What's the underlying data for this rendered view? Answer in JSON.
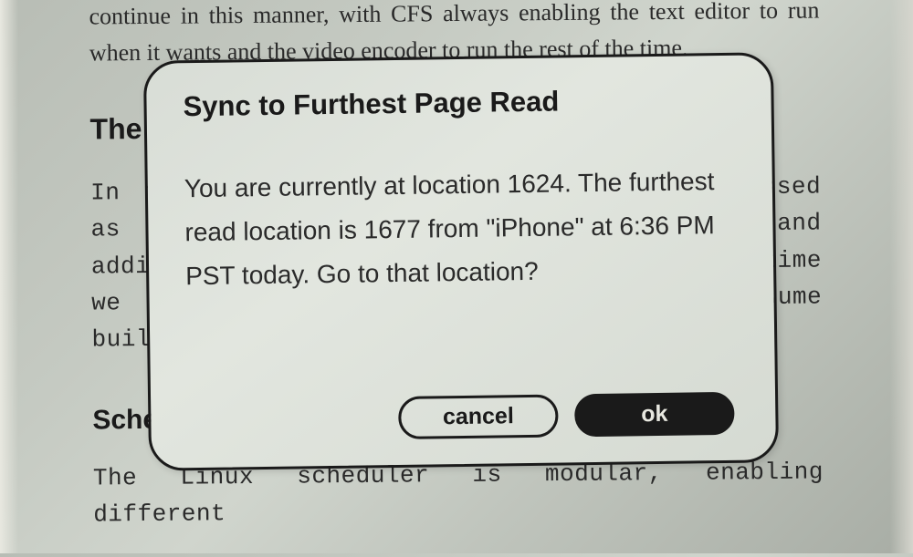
{
  "page": {
    "para1": "continue in this manner, with CFS always enabling the text editor to run when it wants and the video encoder to run the rest of the time.",
    "heading1": "The",
    "para2": "In the CFS scheduler, priorities are expressed as scheduler classes and nice values and additional mentions amount of processor time we want to realize a given task to consume built, we can express scheduling via",
    "heading2": "Scheduler Classes",
    "para3": "The Linux scheduler is modular, enabling different"
  },
  "dialog": {
    "title": "Sync to Furthest Page Read",
    "message": "You are currently at location 1624. The furthest read location is 1677 from \"iPhone\" at 6:36 PM PST today. Go to that location?",
    "cancel_label": "cancel",
    "ok_label": "ok"
  }
}
